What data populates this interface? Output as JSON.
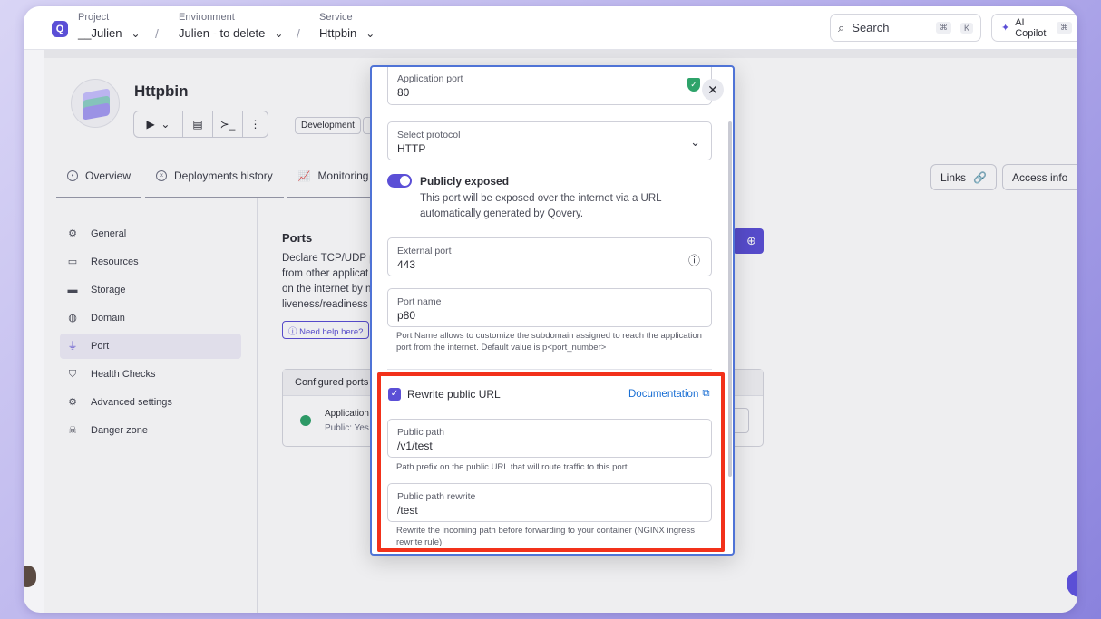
{
  "topbar": {
    "project": {
      "label": "Project",
      "value": "__Julien"
    },
    "environment": {
      "label": "Environment",
      "value": "Julien - to delete"
    },
    "service": {
      "label": "Service",
      "value": "Httpbin"
    },
    "separator": "/",
    "search_placeholder": "Search",
    "search_kbd_1": "⌘",
    "search_kbd_2": "K",
    "copilot_label": "AI Copilot",
    "copilot_kbd": "⌘"
  },
  "header": {
    "service_title": "Httpbin",
    "tag": "Development",
    "tabs": [
      {
        "label": "Overview"
      },
      {
        "label": "Deployments history"
      },
      {
        "label": "Monitoring"
      }
    ],
    "links_label": "Links",
    "access_label": "Access info"
  },
  "sidebar": {
    "items": [
      {
        "label": "General",
        "icon": "gear-icon"
      },
      {
        "label": "Resources",
        "icon": "server-icon"
      },
      {
        "label": "Storage",
        "icon": "storage-icon"
      },
      {
        "label": "Domain",
        "icon": "globe-icon"
      },
      {
        "label": "Port",
        "icon": "plug-icon",
        "active": true
      },
      {
        "label": "Health Checks",
        "icon": "shield-icon"
      },
      {
        "label": "Advanced settings",
        "icon": "gears-icon"
      },
      {
        "label": "Danger zone",
        "icon": "skull-icon"
      }
    ]
  },
  "main": {
    "title": "Ports",
    "desc_lines": [
      "Declare TCP/UDP p",
      "from other applicat",
      "on the internet by n",
      "liveness/readiness"
    ],
    "help_label": "Need help here?",
    "configured_title": "Configured ports",
    "row_name": "Application",
    "row_sub": "Public: Yes"
  },
  "modal": {
    "app_port": {
      "label": "Application port",
      "value": "80"
    },
    "protocol": {
      "label": "Select protocol",
      "value": "HTTP"
    },
    "publicly_exposed_title": "Publicly exposed",
    "publicly_exposed_desc": "This port will be exposed over the internet via a URL automatically generated by Qovery.",
    "external_port": {
      "label": "External port",
      "value": "443"
    },
    "port_name": {
      "label": "Port name",
      "value": "p80"
    },
    "port_name_hint": "Port Name allows to customize the subdomain assigned to reach the application port from the internet. Default value is p<port_number>",
    "rewrite_label": "Rewrite public URL",
    "docs_label": "Documentation",
    "public_path": {
      "label": "Public path",
      "value": "/v1/test"
    },
    "public_path_hint": "Path prefix on the public URL that will route traffic to this port.",
    "public_path_rewrite": {
      "label": "Public path rewrite",
      "value": "/test"
    },
    "public_path_rewrite_hint": "Rewrite the incoming path before forwarding to your container (NGINX ingress rewrite rule)."
  },
  "colors": {
    "accent": "#5b4fd6",
    "highlight": "#f2311a",
    "link": "#1a6fd4",
    "success": "#2ea36a"
  }
}
